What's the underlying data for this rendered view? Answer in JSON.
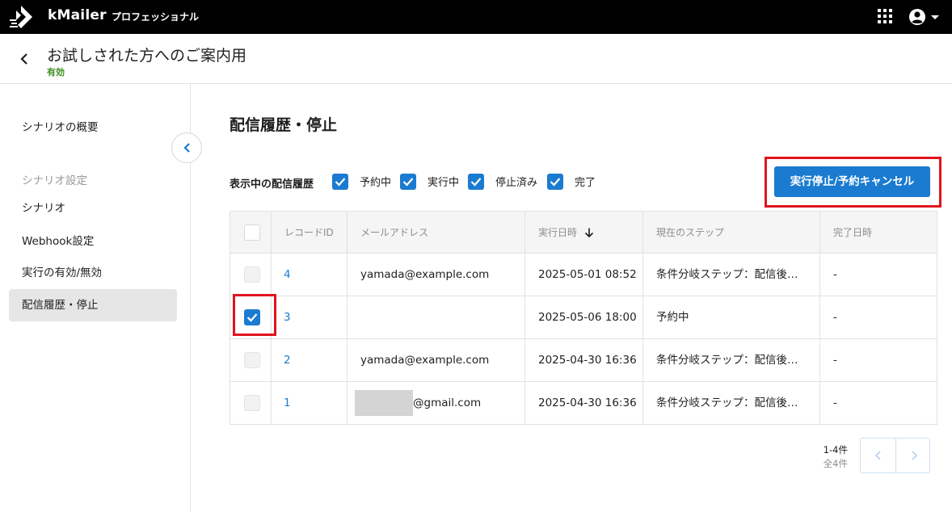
{
  "app": {
    "brand": "kMailer",
    "edition": "プロフェッショナル"
  },
  "header": {
    "title": "お試しされた方へのご案内用",
    "status": "有効"
  },
  "sidebar": {
    "items": [
      {
        "label": "シナリオの概要"
      },
      {
        "label": "シナリオ"
      },
      {
        "label": "Webhook設定"
      },
      {
        "label": "実行の有効/無効"
      },
      {
        "label": "配信履歴・停止"
      }
    ],
    "group_label": "シナリオ設定"
  },
  "main": {
    "section_title": "配信履歴・停止",
    "filter_label": "表示中の配信履歴",
    "filters": [
      {
        "label": "予約中",
        "checked": true
      },
      {
        "label": "実行中",
        "checked": true
      },
      {
        "label": "停止済み",
        "checked": true
      },
      {
        "label": "完了",
        "checked": true
      }
    ],
    "stop_button": "実行停止/予約キャンセル"
  },
  "table": {
    "columns": [
      "レコードID",
      "メールアドレス",
      "実行日時",
      "現在のステップ",
      "完了日時"
    ],
    "rows": [
      {
        "id": "4",
        "email": "yamada@example.com",
        "executed_at": "2025-05-01 08:52",
        "step": "条件分岐ステップ：配信後…",
        "completed_at": "-",
        "selected": false
      },
      {
        "id": "3",
        "email": "",
        "executed_at": "2025-05-06 18:00",
        "step": "予約中",
        "completed_at": "-",
        "selected": true
      },
      {
        "id": "2",
        "email": "yamada@example.com",
        "executed_at": "2025-04-30 16:36",
        "step": "条件分岐ステップ：配信後…",
        "completed_at": "-",
        "selected": false
      },
      {
        "id": "1",
        "email": "@gmail.com",
        "executed_at": "2025-04-30 16:36",
        "step": "条件分岐ステップ：配信後…",
        "completed_at": "-",
        "selected": false
      }
    ]
  },
  "pagination": {
    "range": "1-4件",
    "total": "全4件"
  },
  "colors": {
    "accent": "#1a7bd0",
    "highlight": "#e0141e",
    "status_active": "#3b8f1f"
  }
}
